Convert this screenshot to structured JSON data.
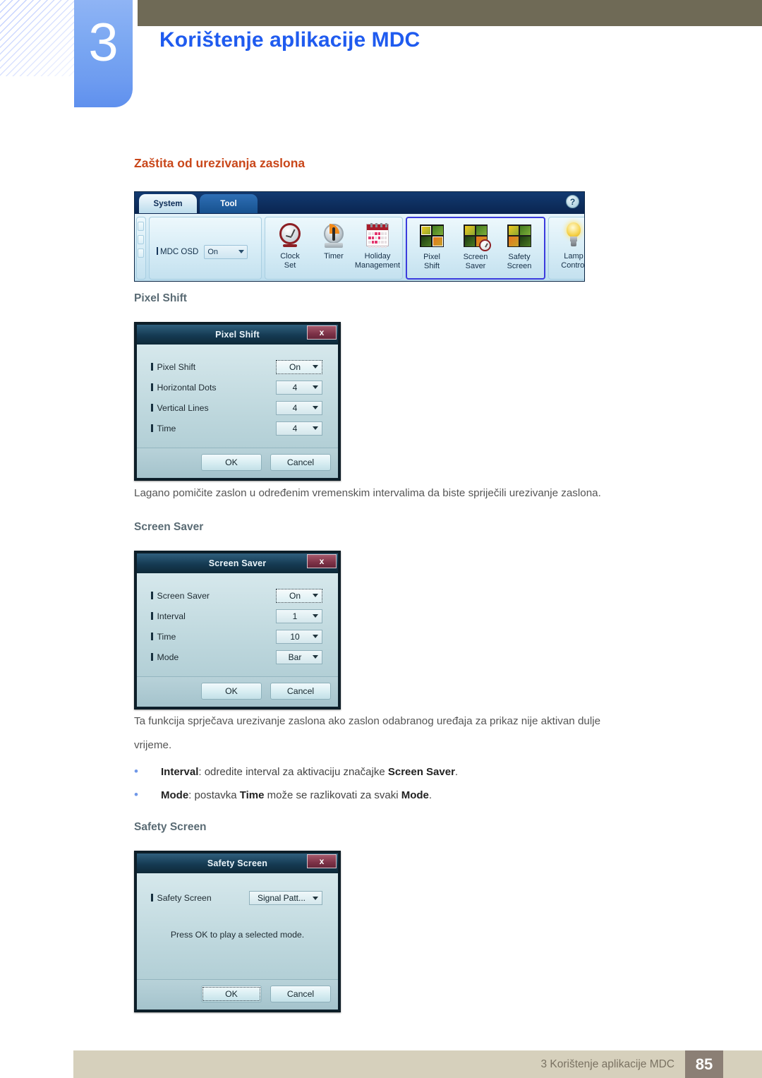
{
  "header": {
    "chapter_number": "3",
    "chapter_title": "Korištenje aplikacije MDC",
    "accent_blue": "#1f5bef",
    "tab_blue": "#7aa7f2",
    "olive": "#6f6a56"
  },
  "section": {
    "title": "Zaštita od urezivanja zaslona",
    "title_color": "#c9471a"
  },
  "ribbon": {
    "tabs": [
      {
        "label": "System",
        "active": true
      },
      {
        "label": "Tool",
        "active": false
      }
    ],
    "help_label": "?",
    "osd": {
      "label": "MDC OSD",
      "value": "On"
    },
    "groups": [
      {
        "name": "clock-group",
        "highlight": false,
        "icons": [
          {
            "name": "clock-set",
            "caption": "Clock\nSet"
          },
          {
            "name": "timer",
            "caption": "Timer"
          },
          {
            "name": "holiday-management",
            "caption": "Holiday\nManagement"
          }
        ]
      },
      {
        "name": "screen-protection-group",
        "highlight": true,
        "icons": [
          {
            "name": "pixel-shift",
            "caption": "Pixel\nShift"
          },
          {
            "name": "screen-saver",
            "caption": "Screen\nSaver"
          },
          {
            "name": "safety-screen",
            "caption": "Safety\nScreen"
          }
        ]
      },
      {
        "name": "lamp-group",
        "highlight": false,
        "icons": [
          {
            "name": "lamp-control",
            "caption": "Lamp\nControl"
          }
        ]
      }
    ]
  },
  "pixel_shift": {
    "heading": "Pixel Shift",
    "dialog_title": "Pixel Shift",
    "close_label": "x",
    "rows": [
      {
        "label": "Pixel Shift",
        "value": "On",
        "focused": true
      },
      {
        "label": "Horizontal Dots",
        "value": "4",
        "focused": false
      },
      {
        "label": "Vertical Lines",
        "value": "4",
        "focused": false
      },
      {
        "label": "Time",
        "value": "4",
        "focused": false
      }
    ],
    "ok_label": "OK",
    "cancel_label": "Cancel",
    "description": "Lagano pomičite zaslon u određenim vremenskim intervalima da biste spriječili urezivanje zaslona."
  },
  "screen_saver": {
    "heading": "Screen Saver",
    "dialog_title": "Screen Saver",
    "close_label": "x",
    "rows": [
      {
        "label": "Screen Saver",
        "value": "On",
        "focused": true
      },
      {
        "label": "Interval",
        "value": "1",
        "focused": false
      },
      {
        "label": "Time",
        "value": "10",
        "focused": false
      },
      {
        "label": "Mode",
        "value": "Bar",
        "focused": false
      }
    ],
    "ok_label": "OK",
    "cancel_label": "Cancel",
    "description_line1": "Ta funkcija sprječava urezivanje zaslona ako zaslon odabranog uređaja za prikaz nije aktivan dulje",
    "description_line2": "vrijeme.",
    "bullets": [
      {
        "parts": [
          {
            "t": "Interval",
            "b": true
          },
          {
            "t": ": odredite interval za aktivaciju značajke ",
            "b": false
          },
          {
            "t": "Screen Saver",
            "b": true
          },
          {
            "t": ".",
            "b": false
          }
        ]
      },
      {
        "parts": [
          {
            "t": "Mode",
            "b": true
          },
          {
            "t": ": postavka ",
            "b": false
          },
          {
            "t": "Time",
            "b": true
          },
          {
            "t": " može se razlikovati za svaki ",
            "b": false
          },
          {
            "t": "Mode",
            "b": true
          },
          {
            "t": ".",
            "b": false
          }
        ]
      }
    ]
  },
  "safety_screen": {
    "heading": "Safety Screen",
    "dialog_title": "Safety Screen",
    "close_label": "x",
    "rows": [
      {
        "label": "Safety Screen",
        "value": "Signal Patt...",
        "focused": false
      }
    ],
    "note": "Press OK to play a selected mode.",
    "ok_label": "OK",
    "cancel_label": "Cancel"
  },
  "footer": {
    "text": "3 Korištenje aplikacije MDC",
    "page": "85",
    "bar_color": "#d6d0bc",
    "page_color": "#8b7f75"
  }
}
